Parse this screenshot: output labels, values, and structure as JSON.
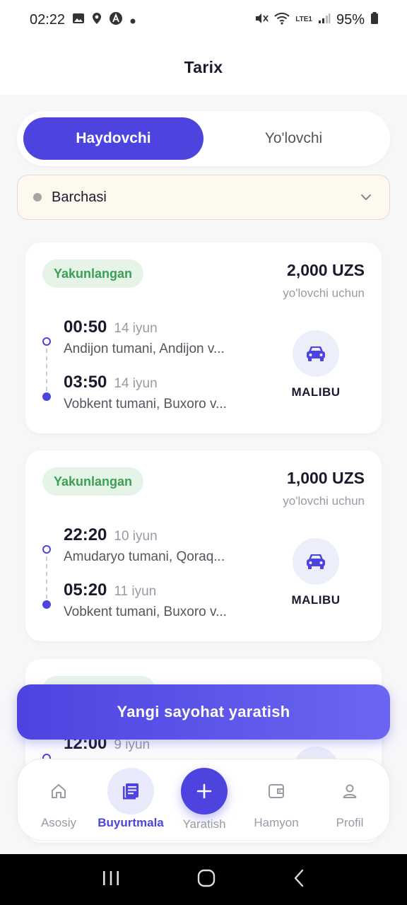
{
  "status_bar": {
    "time": "02:22",
    "battery": "95%",
    "network": "LTE1"
  },
  "header": {
    "title": "Tarix"
  },
  "tabs": [
    {
      "label": "Haydovchi",
      "active": true
    },
    {
      "label": "Yo'lovchi",
      "active": false
    }
  ],
  "filter": {
    "label": "Barchasi"
  },
  "trips": [
    {
      "status": "Yakunlangan",
      "price": "2,000 UZS",
      "price_sub": "yo'lovchi uchun",
      "from_time": "00:50",
      "from_date": "14 iyun",
      "from_addr": "Andijon tumani, Andijon v...",
      "to_time": "03:50",
      "to_date": "14 iyun",
      "to_addr": "Vobkent tumani, Buxoro v...",
      "car": "MALIBU"
    },
    {
      "status": "Yakunlangan",
      "price": "1,000 UZS",
      "price_sub": "yo'lovchi uchun",
      "from_time": "22:20",
      "from_date": "10 iyun",
      "from_addr": "Amudaryo tumani, Qoraq...",
      "to_time": "05:20",
      "to_date": "11 iyun",
      "to_addr": "Vobkent tumani, Buxoro v...",
      "car": "MALIBU"
    },
    {
      "from_time": "12:00",
      "from_date": "9 iyun"
    }
  ],
  "create_button": {
    "label": "Yangi sayohat yaratish"
  },
  "bottom_nav": [
    {
      "label": "Asosiy",
      "icon": "home-icon",
      "active": false
    },
    {
      "label": "Buyurtmala",
      "icon": "orders-icon",
      "active": true
    },
    {
      "label": "Yaratish",
      "icon": "plus-icon",
      "active": false
    },
    {
      "label": "Hamyon",
      "icon": "wallet-icon",
      "active": false
    },
    {
      "label": "Profil",
      "icon": "user-icon",
      "active": false
    }
  ],
  "colors": {
    "primary": "#4d44e0",
    "success_bg": "#e6f4e8",
    "success_text": "#3aa055"
  }
}
